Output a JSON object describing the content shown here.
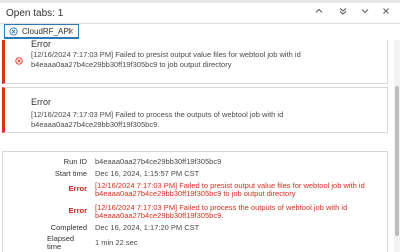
{
  "header": {
    "title": "Open tabs: 1"
  },
  "tabs": [
    {
      "label": "CloudRF_API"
    }
  ],
  "errors": [
    {
      "title": "Error",
      "message": "[12/16/2024 7:17:03 PM] Failed to presist output value files for webtool job with id b4eaaa0aa27b4ce29bb30ff19f305bc9 to job output directory"
    },
    {
      "title": "Error",
      "message": "[12/16/2024 7:17:03 PM] Failed to process the outputs of webtool job with id b4eaaa0aa27b4ce29bb30ff19f305bc9."
    }
  ],
  "summary": {
    "run_id_label": "Run ID",
    "run_id": "b4eaaa0aa27b4ce29bb30ff19f305bc9",
    "start_time_label": "Start time",
    "start_time": "Dec 16, 2024, 1:15:57 PM CST",
    "error1_label": "Error",
    "error1": "[12/16/2024 7:17:03 PM] Failed to presist output value files for webtool job with id b4eaaa0aa27b4ce29bb30ff19f305bc9 to job output directory",
    "error2_label": "Error",
    "error2": "[12/16/2024 7:17:03 PM] Failed to process the outputs of webtool job with id b4eaaa0aa27b4ce29bb30ff19f305bc9.",
    "completed_label": "Completed",
    "completed": "Dec 16, 2024, 1:17:20 PM CST",
    "elapsed_label": "Elapsed time",
    "elapsed": "1 min 22 sec"
  },
  "colors": {
    "error": "#d83020",
    "accent": "#2a7ab8"
  },
  "icons": {
    "header": [
      "chevron-up-icon",
      "chevrons-down-icon",
      "chevron-down-icon",
      "close-icon"
    ],
    "tab": "error-circle-icon",
    "error": "error-circle-icon"
  }
}
